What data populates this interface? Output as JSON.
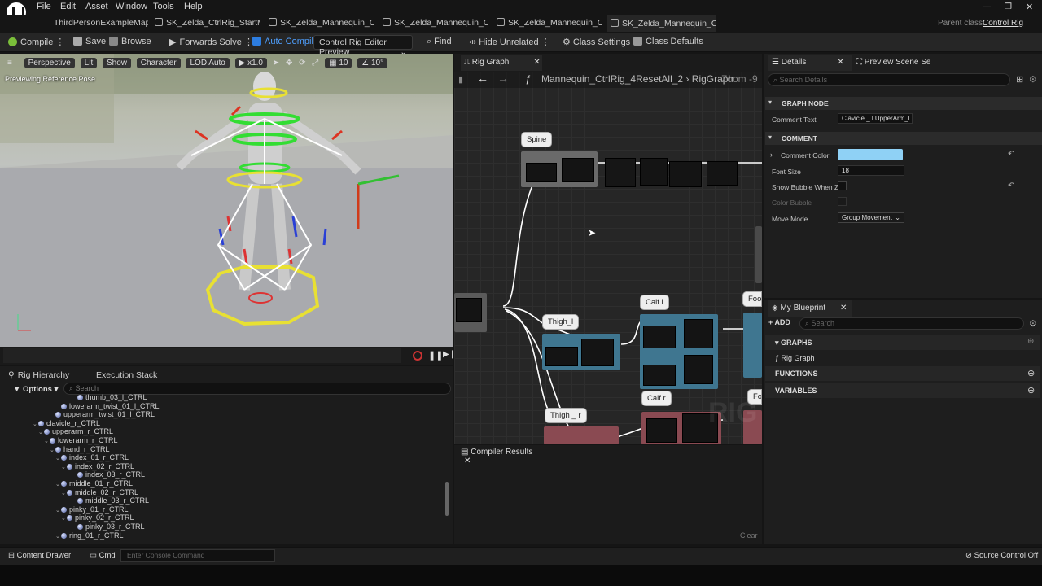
{
  "menu": [
    "File",
    "Edit",
    "Asset",
    "Window",
    "Tools",
    "Help"
  ],
  "tabs": [
    {
      "label": "ThirdPersonExampleMap"
    },
    {
      "label": "SK_Zelda_CtrlRig_StartMa"
    },
    {
      "label": "SK_Zelda_Mannequin_Ctr•"
    },
    {
      "label": "SK_Zelda_Mannequin_Ctrl"
    },
    {
      "label": "SK_Zelda_Mannequin_Ctr•"
    },
    {
      "label": "SK_Zelda_Mannequin_Ctrl"
    }
  ],
  "window": {
    "parent_class_label": "Parent class:",
    "parent_class_value": "Control Rig"
  },
  "toolbar": {
    "compile": "Compile",
    "save": "Save",
    "browse": "Browse",
    "forwards_solve": "Forwards Solve",
    "auto_compile": "Auto Compile",
    "preview_dropdown": "Control Rig Editor Preview",
    "find": "Find",
    "hide_unrelated": "Hide Unrelated",
    "class_settings": "Class Settings",
    "class_defaults": "Class Defaults"
  },
  "viewport": {
    "perspective": "Perspective",
    "lit": "Lit",
    "show": "Show",
    "character": "Character",
    "lod": "LOD Auto",
    "speed": "x1.0",
    "grid_value": "10",
    "angle_value": "10°",
    "overlay_text": "Previewing Reference Pose"
  },
  "hierarchy": {
    "tab_rig": "Rig Hierarchy",
    "tab_exec": "Execution Stack",
    "options": "Options",
    "search_placeholder": "Search",
    "rows": [
      {
        "label": "thumb_03_l_CTRL",
        "indent": 88,
        "caret": ""
      },
      {
        "label": "lowerarm_twist_01_l_CTRL",
        "indent": 68,
        "caret": ""
      },
      {
        "label": "upperarm_twist_01_l_CTRL",
        "indent": 61,
        "caret": ""
      },
      {
        "label": "clavicle_r_CTRL",
        "indent": 40,
        "caret": "v"
      },
      {
        "label": "upperarm_r_CTRL",
        "indent": 47,
        "caret": "v"
      },
      {
        "label": "lowerarm_r_CTRL",
        "indent": 54,
        "caret": "v"
      },
      {
        "label": "hand_r_CTRL",
        "indent": 61,
        "caret": "v"
      },
      {
        "label": "index_01_r_CTRL",
        "indent": 68,
        "caret": "v"
      },
      {
        "label": "index_02_r_CTRL",
        "indent": 75,
        "caret": "v"
      },
      {
        "label": "index_03_r_CTRL",
        "indent": 88,
        "caret": ""
      },
      {
        "label": "middle_01_r_CTRL",
        "indent": 68,
        "caret": "v"
      },
      {
        "label": "middle_02_r_CTRL",
        "indent": 75,
        "caret": "v"
      },
      {
        "label": "middle_03_r_CTRL",
        "indent": 88,
        "caret": ""
      },
      {
        "label": "pinky_01_r_CTRL",
        "indent": 68,
        "caret": "v"
      },
      {
        "label": "pinky_02_r_CTRL",
        "indent": 75,
        "caret": "v"
      },
      {
        "label": "pinky_03_r_CTRL",
        "indent": 88,
        "caret": ""
      },
      {
        "label": "ring_01_r_CTRL",
        "indent": 68,
        "caret": "v"
      }
    ]
  },
  "graph": {
    "tab": "Rig Graph",
    "breadcrumb": "Mannequin_CtrlRig_4ResetAll_2",
    "breadcrumb_sub": "RigGraph",
    "zoom": "Zoom -9",
    "bubbles": {
      "spine": "Spine",
      "thigh_l": "Thigh_l",
      "calf_l": "Calf l",
      "calf_r": "Calf r",
      "thigh_r": "Thigh _ r",
      "foot": "Foo",
      "foot2": "Fo"
    },
    "watermark": "RIG"
  },
  "compiler": {
    "tab": "Compiler Results",
    "clear": "Clear"
  },
  "details": {
    "tab": "Details",
    "tab2": "Preview Scene Se",
    "search_placeholder": "Search Details",
    "section_graph_node": "GRAPH NODE",
    "comment_text_label": "Comment Text",
    "comment_text_value": "Clavicle _ l UpperArm_l",
    "section_comment": "COMMENT",
    "comment_color_label": "Comment Color",
    "comment_color": "#8fd1f5",
    "font_size_label": "Font Size",
    "font_size_value": "18",
    "show_bubble_label": "Show Bubble When Zo",
    "color_bubble_label": "Color Bubble",
    "move_mode_label": "Move Mode",
    "move_mode_value": "Group Movement"
  },
  "blueprint": {
    "tab": "My Blueprint",
    "add": "ADD",
    "search_placeholder": "Search",
    "graphs": "GRAPHS",
    "rig_graph": "Rig Graph",
    "functions": "FUNCTIONS",
    "variables": "VARIABLES"
  },
  "statusbar": {
    "content_drawer": "Content Drawer",
    "cmd": "Cmd",
    "console_placeholder": "Enter Console Command",
    "source_control": "Source Control Off"
  }
}
